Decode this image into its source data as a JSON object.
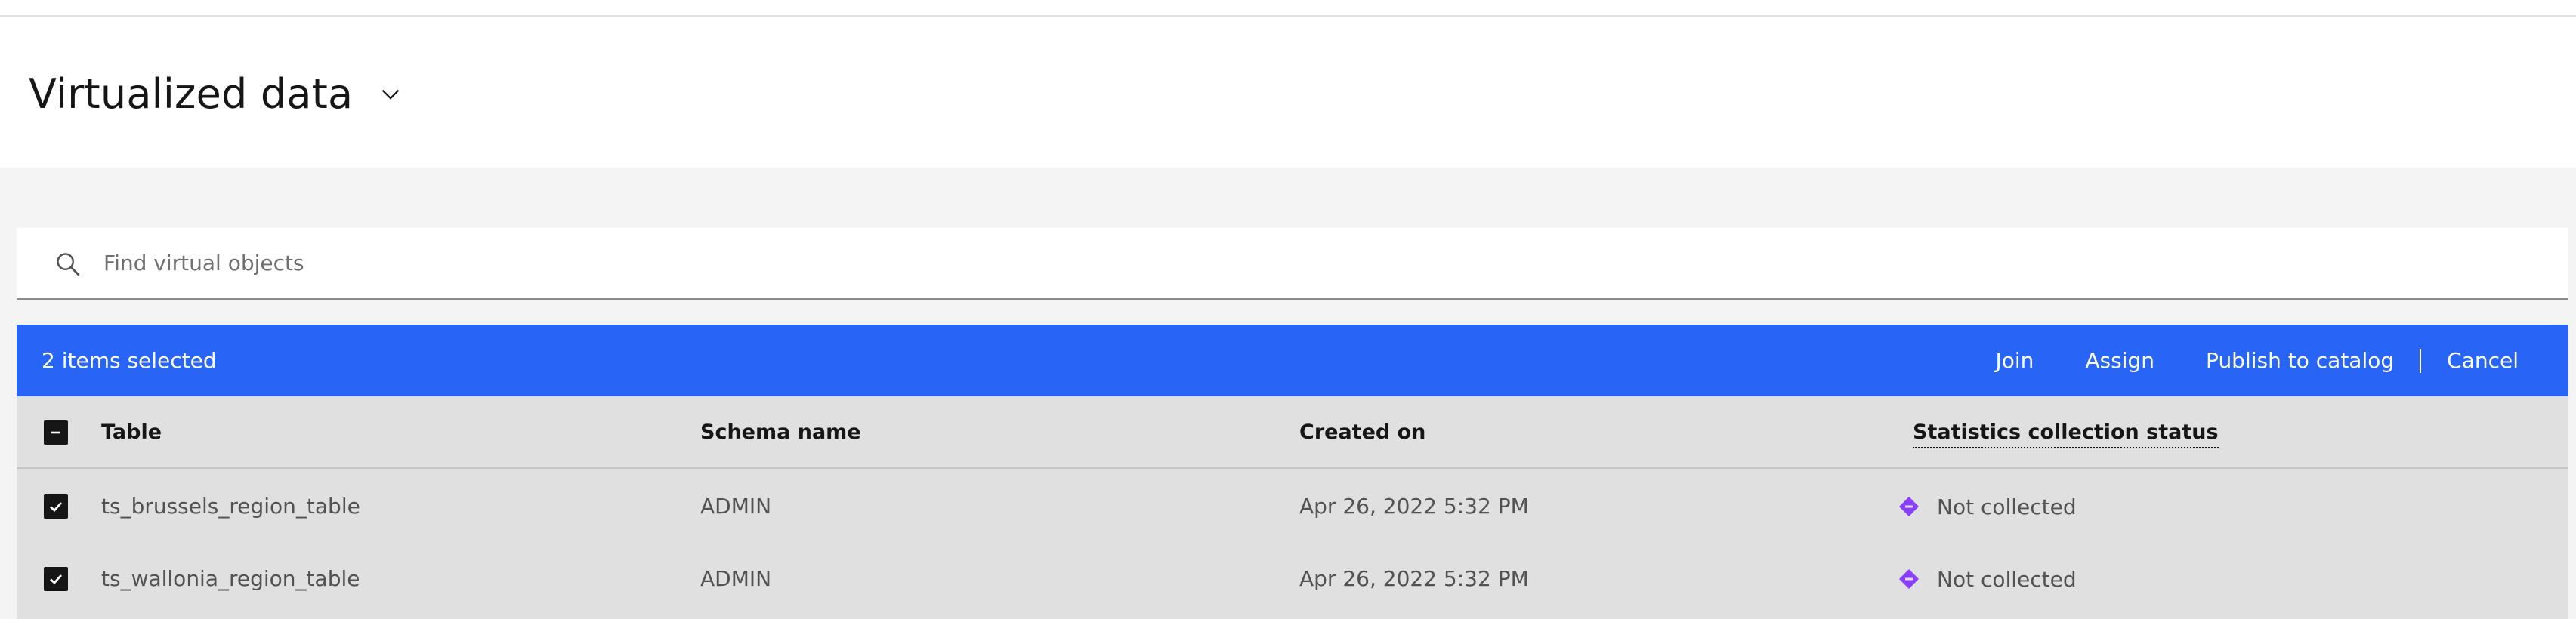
{
  "header": {
    "title": "Virtualized data"
  },
  "search": {
    "placeholder": "Find virtual objects",
    "value": ""
  },
  "batch": {
    "selected_text": "2 items selected",
    "actions": {
      "join": "Join",
      "assign": "Assign",
      "publish": "Publish to catalog",
      "cancel": "Cancel"
    }
  },
  "table": {
    "columns": {
      "table": "Table",
      "schema": "Schema name",
      "created": "Created on",
      "status": "Statistics collection status"
    },
    "rows": [
      {
        "table": "ts_brussels_region_table",
        "schema": "ADMIN",
        "created": "Apr 26, 2022 5:32 PM",
        "status": "Not collected",
        "selected": true
      },
      {
        "table": "ts_wallonia_region_table",
        "schema": "ADMIN",
        "created": "Apr 26, 2022 5:32 PM",
        "status": "Not collected",
        "selected": true
      }
    ]
  },
  "colors": {
    "batch_bar": "#2864f6",
    "status_icon": "#8a3ffc",
    "table_bg": "#e0e0e0"
  },
  "icons": {
    "search": "search-icon",
    "chevron": "chevron-down-icon",
    "status": "diamond-status-icon",
    "checkbox_checked": "checkmark-icon",
    "checkbox_indeterminate": "minus-icon"
  }
}
